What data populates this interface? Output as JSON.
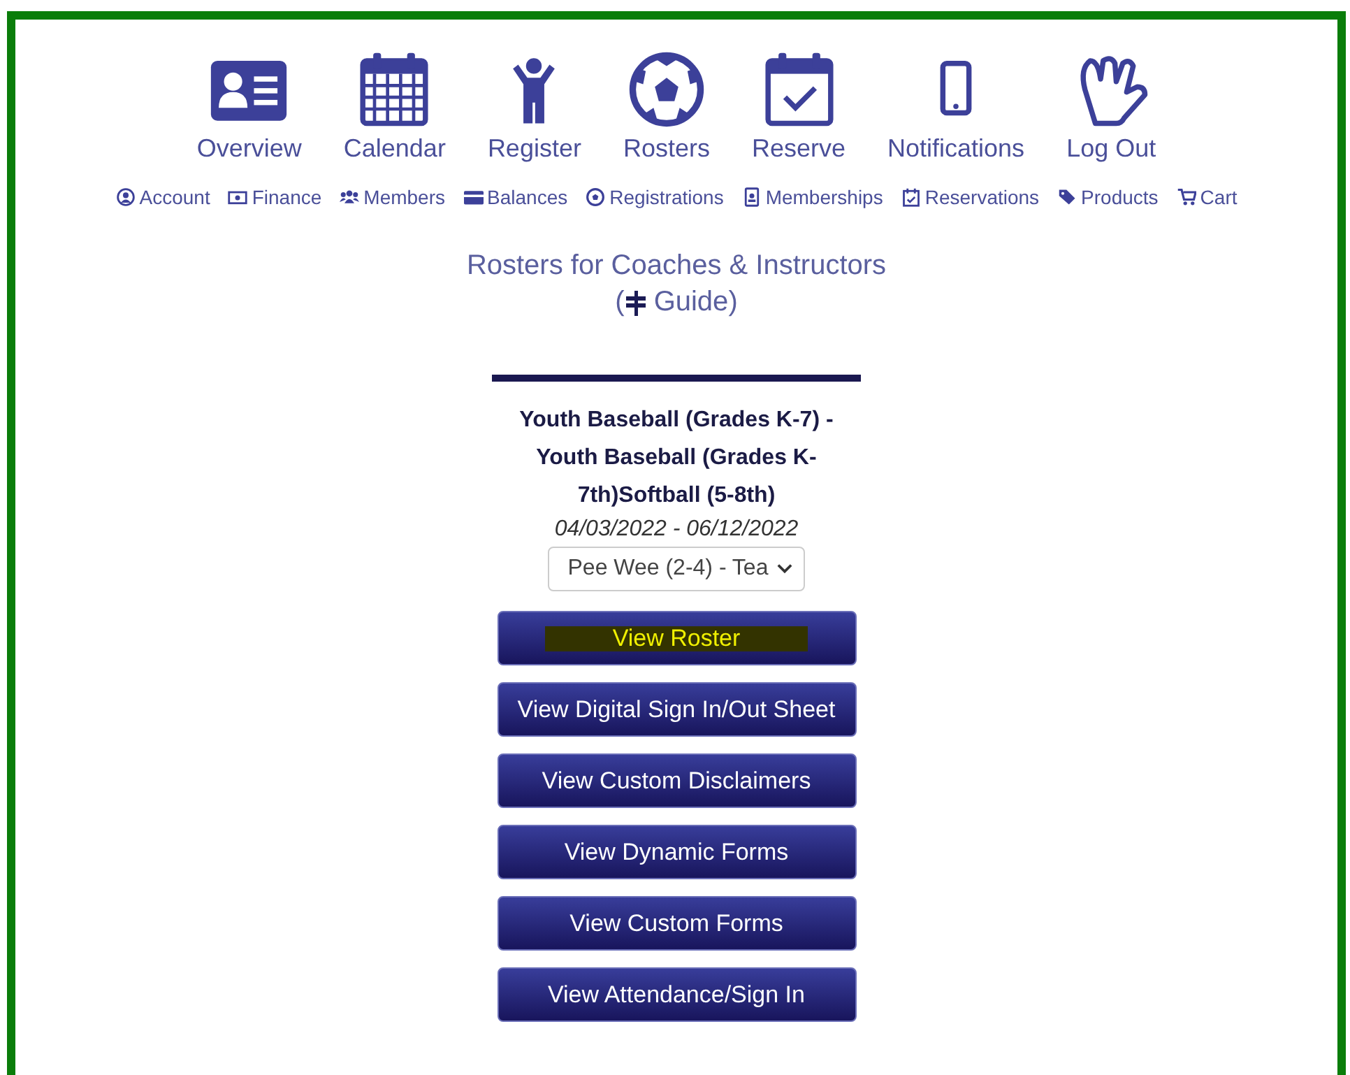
{
  "main_nav": [
    {
      "label": "Overview",
      "kind": "card"
    },
    {
      "label": "Calendar",
      "kind": "calendar"
    },
    {
      "label": "Register",
      "kind": "person"
    },
    {
      "label": "Rosters",
      "kind": "ball"
    },
    {
      "label": "Reserve",
      "kind": "check"
    },
    {
      "label": "Notifications",
      "kind": "phone"
    },
    {
      "label": "Log Out",
      "kind": "hand"
    }
  ],
  "sub_nav": [
    {
      "label": "Account",
      "kind": "user"
    },
    {
      "label": "Finance",
      "kind": "money"
    },
    {
      "label": "Members",
      "kind": "users"
    },
    {
      "label": "Balances",
      "kind": "creditcard"
    },
    {
      "label": "Registrations",
      "kind": "ball"
    },
    {
      "label": "Memberships",
      "kind": "badge"
    },
    {
      "label": "Reservations",
      "kind": "calendar"
    },
    {
      "label": "Products",
      "kind": "tags"
    },
    {
      "label": "Cart",
      "kind": "cart"
    }
  ],
  "page_title": "Rosters for Coaches & Instructors",
  "guide_link": "Guide",
  "guide_parens": [
    "(",
    ")"
  ],
  "program": {
    "name": "Youth Baseball (Grades K-7) - Youth Baseball (Grades K-7th)Softball (5-8th)",
    "dates": "04/03/2022 - 06/12/2022",
    "team_select": "Pee Wee (2-4) - Tea"
  },
  "buttons": [
    {
      "label": "View Roster",
      "highlighted": true
    },
    {
      "label": "View Digital Sign In/Out Sheet",
      "highlighted": false
    },
    {
      "label": "View Custom Disclaimers",
      "highlighted": false
    },
    {
      "label": "View Dynamic Forms",
      "highlighted": false
    },
    {
      "label": "View Custom Forms",
      "highlighted": false
    },
    {
      "label": "View Attendance/Sign In",
      "highlighted": false
    }
  ]
}
